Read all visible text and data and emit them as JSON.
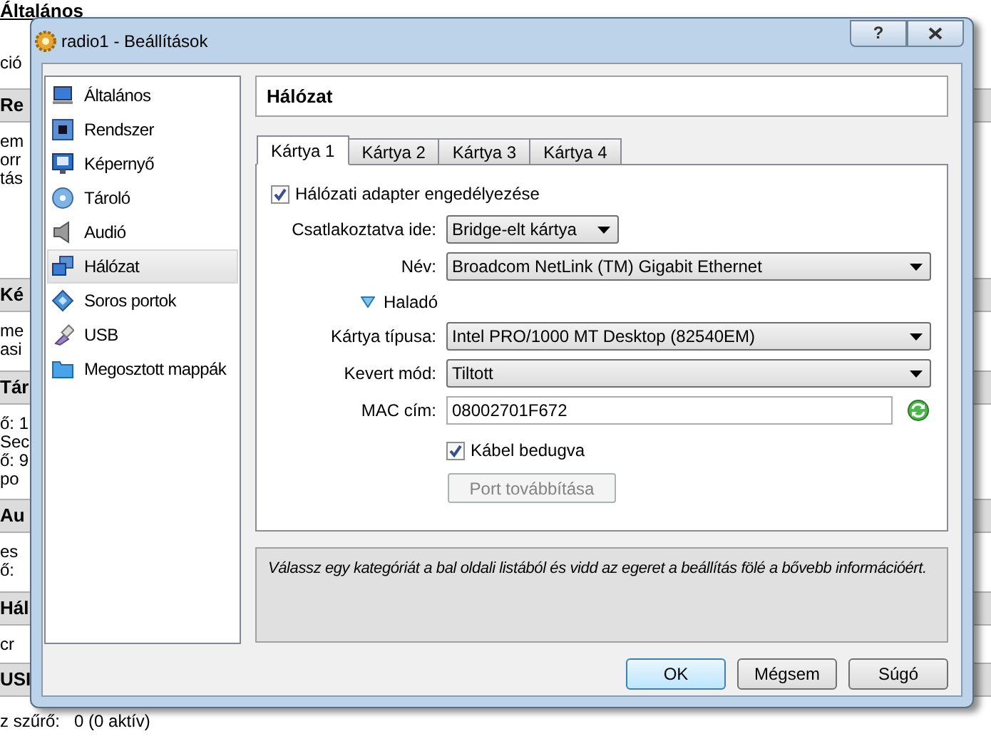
{
  "background_window": {
    "sections": [
      {
        "header": "Általános",
        "kind": "link",
        "lines": [
          "ció"
        ]
      },
      {
        "header": "Re",
        "kind": "band",
        "lines": [
          "em",
          "orr",
          "tás"
        ]
      },
      {
        "header": "Ké",
        "kind": "band",
        "lines": [
          "me",
          "asi"
        ]
      },
      {
        "header": "Tár",
        "kind": "band",
        "lines": [
          "ő: 1",
          "Sec",
          "ő: 9",
          "po"
        ]
      },
      {
        "header": "Au",
        "kind": "band",
        "lines": [
          "es",
          "ő:"
        ]
      },
      {
        "header": "Hál",
        "kind": "band",
        "lines": [
          "cr"
        ]
      },
      {
        "header": "USI",
        "kind": "band",
        "lines": [
          "z szűrő:   0 (0 aktív)"
        ]
      }
    ]
  },
  "dialog": {
    "title": "radio1 - Beállítások",
    "help_button": "?",
    "sidebar": {
      "items": [
        {
          "label": "Általános",
          "kind": "general",
          "selected": false
        },
        {
          "label": "Rendszer",
          "kind": "system",
          "selected": false
        },
        {
          "label": "Képernyő",
          "kind": "display",
          "selected": false
        },
        {
          "label": "Tároló",
          "kind": "storage",
          "selected": false
        },
        {
          "label": "Audió",
          "kind": "audio",
          "selected": false
        },
        {
          "label": "Hálózat",
          "kind": "network",
          "selected": true
        },
        {
          "label": "Soros portok",
          "kind": "serial",
          "selected": false
        },
        {
          "label": "USB",
          "kind": "usb",
          "selected": false
        },
        {
          "label": "Megosztott mappák",
          "kind": "shared",
          "selected": false
        }
      ]
    },
    "page_title": "Hálózat",
    "tabs": [
      {
        "label": "Kártya 1",
        "selected": true
      },
      {
        "label": "Kártya 2",
        "selected": false
      },
      {
        "label": "Kártya 3",
        "selected": false
      },
      {
        "label": "Kártya 4",
        "selected": false
      }
    ],
    "adapter_enabled": {
      "label": "Hálózati adapter engedélyezése",
      "checked": true
    },
    "fields_basic": [
      {
        "kind": "short_combo",
        "label": "Csatlakoztatva ide:",
        "value": "Bridge-elt kártya"
      },
      {
        "kind": "combo",
        "label": "Név:",
        "value": "Broadcom NetLink (TM) Gigabit Ethernet"
      }
    ],
    "advanced": {
      "label": "Haladó",
      "expanded": true
    },
    "fields_advanced": [
      {
        "kind": "combo",
        "label": "Kártya típusa:",
        "value": "Intel PRO/1000 MT Desktop (82540EM)"
      },
      {
        "kind": "combo",
        "label": "Kevert mód:",
        "value": "Tiltott"
      },
      {
        "kind": "text",
        "label": "MAC cím:",
        "value": "08002701F672"
      }
    ],
    "cable_connected": {
      "label": "Kábel bedugva",
      "checked": true
    },
    "port_forwarding": {
      "label": "Port továbbítása",
      "disabled": true
    },
    "info_text": "Válassz egy kategóriát a bal oldali listából és vidd az egeret a beállítás fölé a bővebb információért.",
    "buttons": [
      {
        "label": "OK",
        "default": true
      },
      {
        "label": "Mégsem",
        "default": false
      },
      {
        "label": "Súgó",
        "default": false
      }
    ]
  }
}
